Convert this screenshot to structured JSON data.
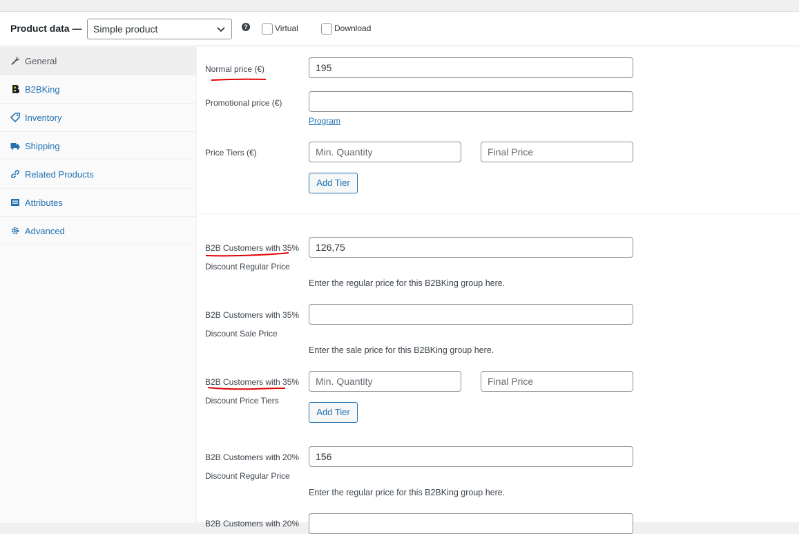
{
  "header": {
    "title": "Product data —",
    "product_type": "Simple product",
    "help_icon": "?",
    "virtual_label": "Virtual",
    "download_label": "Download"
  },
  "sidebar": {
    "tabs": [
      {
        "label": "General",
        "icon": "wrench-icon",
        "active": true
      },
      {
        "label": "B2BKing",
        "icon": "b2bking-icon",
        "active": false
      },
      {
        "label": "Inventory",
        "icon": "tag-icon",
        "active": false
      },
      {
        "label": "Shipping",
        "icon": "truck-icon",
        "active": false
      },
      {
        "label": "Related Products",
        "icon": "link-icon",
        "active": false
      },
      {
        "label": "Attributes",
        "icon": "list-icon",
        "active": false
      },
      {
        "label": "Advanced",
        "icon": "gear-icon",
        "active": false
      }
    ]
  },
  "general": {
    "normal_price_label": "Normal price (€)",
    "normal_price_value": "195",
    "promo_price_label": "Promotional price (€)",
    "promo_price_value": "",
    "program_link": "Program",
    "price_tiers_label": "Price Tiers (€)",
    "min_qty_placeholder": "Min. Quantity",
    "final_price_placeholder": "Final Price",
    "add_tier_label": "Add Tier"
  },
  "b2b": {
    "g35_regular_label_1": "B2B Customers with 35%",
    "g35_regular_label_2": "Discount Regular Price",
    "g35_regular_value": "126,75",
    "regular_help": "Enter the regular price for this B2BKing group here.",
    "g35_sale_label_1": "B2B Customers with 35%",
    "g35_sale_label_2": "Discount Sale Price",
    "g35_sale_value": "",
    "sale_help": "Enter the sale price for this B2BKing group here.",
    "g35_tiers_label_1": "B2B Customers with 35%",
    "g35_tiers_label_2": "Discount Price Tiers",
    "min_qty_placeholder": "Min. Quantity",
    "final_price_placeholder": "Final Price",
    "add_tier_label": "Add Tier",
    "g20_regular_label_1": "B2B Customers with 20%",
    "g20_regular_label_2": "Discount Regular Price",
    "g20_regular_value": "156",
    "regular_help_2": "Enter the regular price for this B2BKing group here.",
    "g20_sale_label_partial": "B2B Customers with 20%"
  },
  "colors": {
    "accent": "#2271b1",
    "annotation": "#e00000"
  }
}
